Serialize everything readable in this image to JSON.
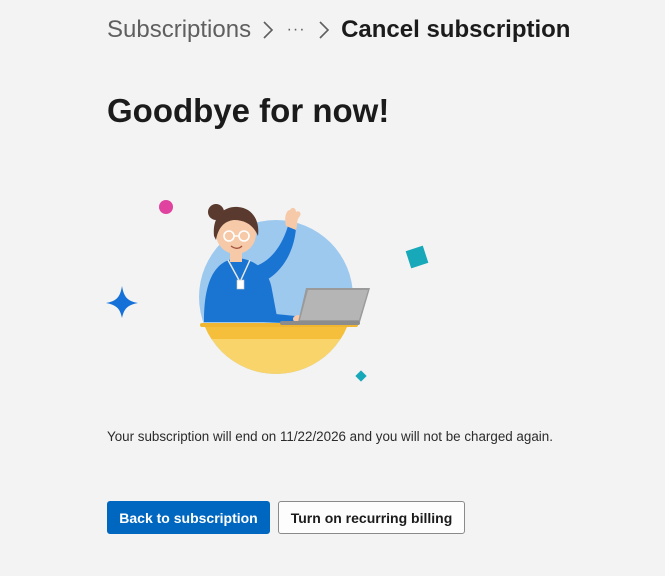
{
  "breadcrumb": {
    "items": [
      {
        "label": "Subscriptions"
      },
      {
        "label": "···"
      },
      {
        "label": "Cancel subscription"
      }
    ]
  },
  "page": {
    "title": "Goodbye for now!",
    "message": "Your subscription will end on 11/22/2026 and you will not be charged again."
  },
  "actions": {
    "primary_label": "Back to subscription",
    "secondary_label": "Turn on recurring billing"
  },
  "colors": {
    "accent": "#0067c0",
    "background": "#f3f3f3",
    "decor_pink": "#e0439f",
    "decor_teal": "#17a9b9",
    "sparkle_blue": "#1570d8"
  },
  "illustration": {
    "subject": "woman-waving-at-laptop"
  }
}
